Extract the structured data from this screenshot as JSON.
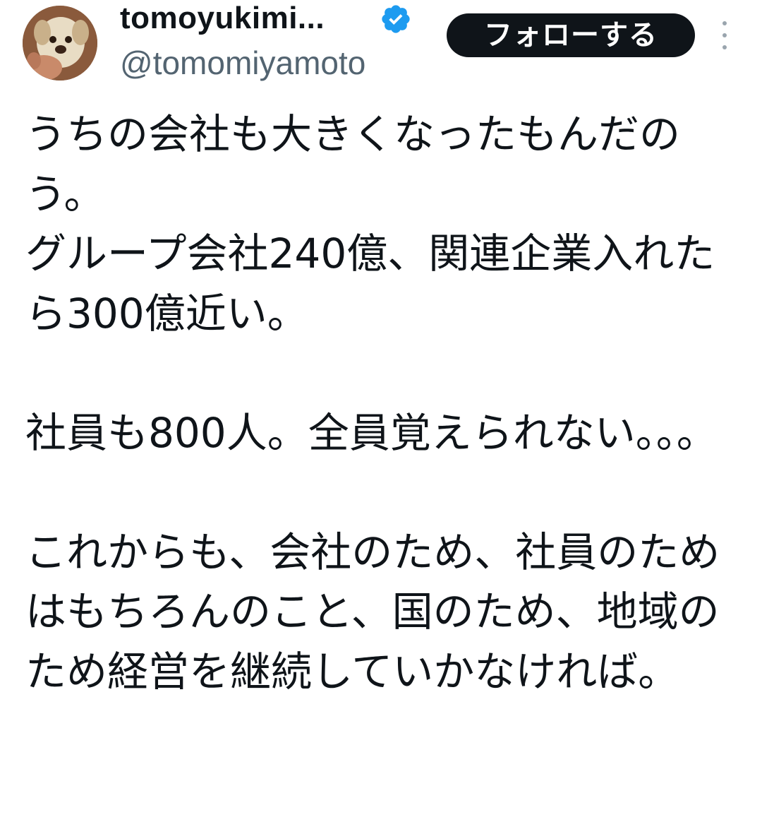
{
  "author": {
    "display_name": "tomoyukimi...",
    "handle": "@tomomiyamoto",
    "verified": true,
    "avatar_icon": "dog-avatar-icon",
    "verified_icon": "verified-badge-icon"
  },
  "actions": {
    "follow_label": "フォローする",
    "more_icon": "more-vertical-icon"
  },
  "tweet": {
    "text": "うちの会社も大きくなったもんだのう。\nグループ会社240億、関連企業入れたら300億近い。\n\n社員も800人。全員覚えられない。。。\n\nこれからも、会社のため、社員のためはもちろんのこと、国のため、地域のため経営を継続していかなければ。"
  },
  "colors": {
    "text": "#0f1419",
    "secondary_text": "#536471",
    "verified_blue": "#1d9bf0",
    "button_bg": "#0f1419",
    "button_text": "#ffffff"
  }
}
